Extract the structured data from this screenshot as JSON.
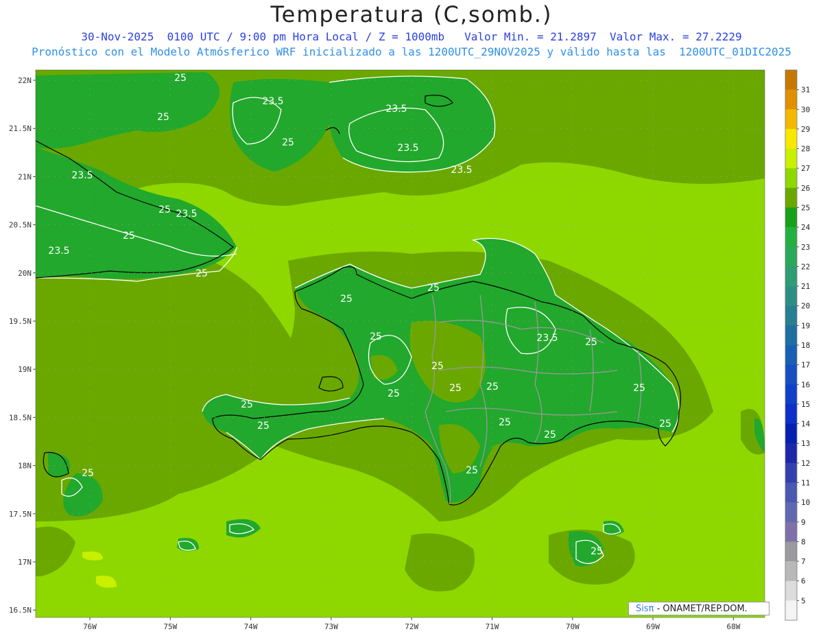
{
  "header": {
    "title": "Temperatura (C,somb.)",
    "line1": "30-Nov-2025  0100 UTC / 9:00 pm Hora Local / Z = 1000mb   Valor Min. = 21.2897  Valor Max. = 27.2229",
    "line2": "Pronóstico con el Modelo Atmósferico WRF inicializado a las 1200UTC_29NOV2025 y válido hasta las  1200UTC_01DIC2025"
  },
  "axes": {
    "lat_labels": [
      "22N",
      "21.5N",
      "21N",
      "20.5N",
      "20N",
      "19.5N",
      "19N",
      "18.5N",
      "18N",
      "17.5N",
      "17N",
      "16.5N"
    ],
    "lon_labels": [
      "76W",
      "75W",
      "74W",
      "73W",
      "72W",
      "71W",
      "70W",
      "69W",
      "68W"
    ]
  },
  "colorbar": {
    "labels": [
      "31",
      "30",
      "29",
      "28",
      "27",
      "26",
      "25",
      "24",
      "23",
      "22",
      "21",
      "20",
      "19",
      "18",
      "17",
      "16",
      "15",
      "14",
      "13",
      "12",
      "11",
      "10",
      "9",
      "8",
      "7",
      "6",
      "5"
    ],
    "colors": [
      "#c47a00",
      "#e09000",
      "#f4b800",
      "#f8e800",
      "#c8f000",
      "#8ed800",
      "#6aa800",
      "#18a018",
      "#22b040",
      "#2aa85a",
      "#2e9c74",
      "#2c8f86",
      "#26808f",
      "#1f6fa0",
      "#1860b4",
      "#1450c0",
      "#1040c8",
      "#0c30c8",
      "#0820b0",
      "#1c28a8",
      "#3340b0",
      "#4a58b0",
      "#6068b0",
      "#8070a8",
      "#9a9aa0",
      "#b8b8b8",
      "#dcdcdc",
      "#f4f4f4"
    ]
  },
  "contours": {
    "labels": [
      "25",
      "23.5",
      "25",
      "23.5",
      "25",
      "23.5",
      "23.5",
      "25",
      "23.5",
      "25",
      "23.5",
      "23.5",
      "25",
      "25",
      "25",
      "25",
      "23.5",
      "25",
      "25",
      "25",
      "25",
      "25",
      "25",
      "25",
      "25",
      "25",
      "25",
      "25",
      "25",
      "25",
      "25"
    ]
  },
  "credit": {
    "brand": "Sisπ",
    "text": " - ONAMET/REP.DOM."
  },
  "colors": {
    "sea_light": "#8ed800",
    "land_mid": "#6aa800",
    "green_dark": "#22a82c",
    "contour": "#ffffff",
    "coast": "#000000",
    "border": "#999999"
  }
}
